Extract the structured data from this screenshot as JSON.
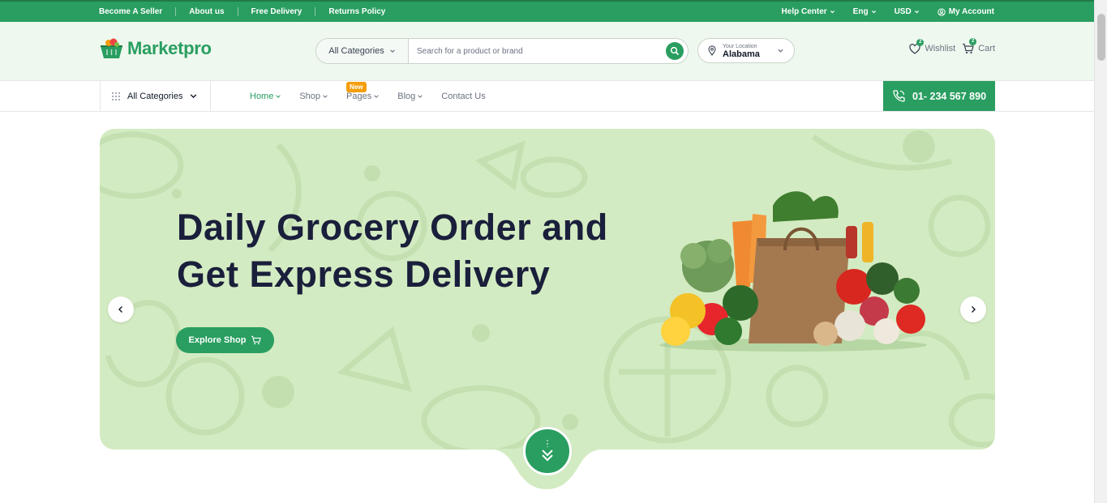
{
  "topbar": {
    "links": [
      "Become A Seller",
      "About us",
      "Free Delivery",
      "Returns Policy"
    ],
    "help_center": "Help Center",
    "language": "Eng",
    "currency": "USD",
    "account": "My Account"
  },
  "header": {
    "logo_text": "Marketpro",
    "search": {
      "category": "All Categories",
      "placeholder": "Search for a product or brand"
    },
    "location": {
      "label": "Your Location",
      "value": "Alabama"
    },
    "wishlist": {
      "label": "Wishlist",
      "count": "2"
    },
    "cart": {
      "label": "Cart",
      "count": "2"
    }
  },
  "nav": {
    "all_categories": "All Categories",
    "menu": [
      {
        "label": "Home"
      },
      {
        "label": "Shop"
      },
      {
        "label": "Pages",
        "badge": "New"
      },
      {
        "label": "Blog"
      },
      {
        "label": "Contact Us"
      }
    ],
    "phone": "01- 234 567 890"
  },
  "hero": {
    "title_line1": "Daily Grocery Order and",
    "title_line2": "Get Express Delivery",
    "button": "Explore Shop"
  },
  "colors": {
    "brand": "#299e60",
    "hero_bg": "#d3ebc2",
    "title": "#1a1f3b",
    "badge": "#f59e0b"
  }
}
